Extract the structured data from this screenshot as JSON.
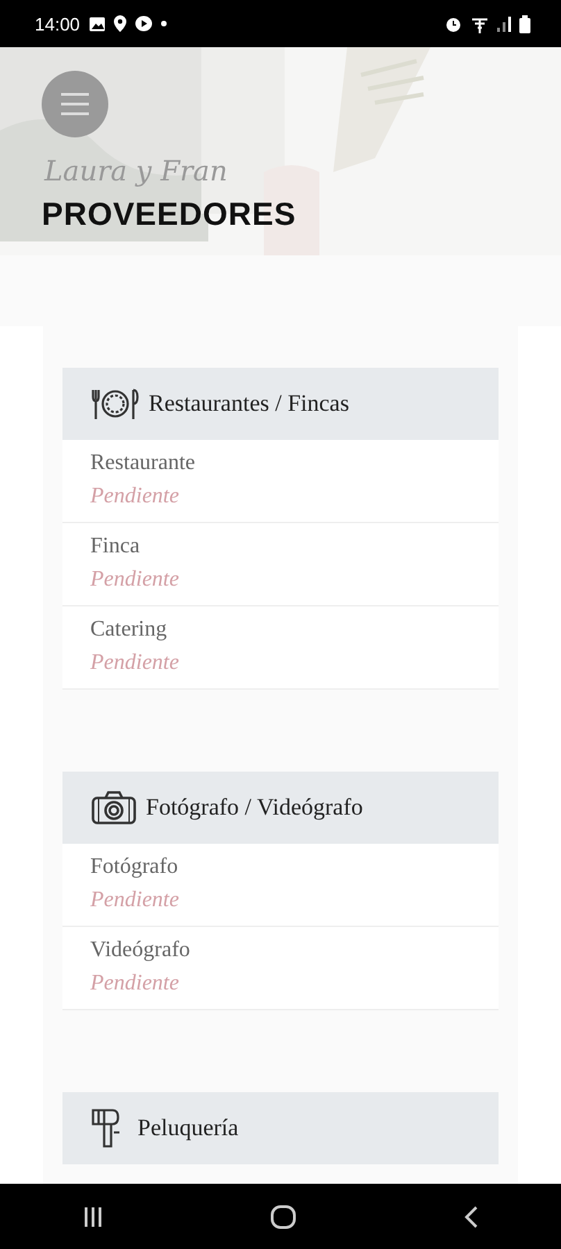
{
  "status_bar": {
    "time": "14:00"
  },
  "header": {
    "logo": "Laura y Fran",
    "title": "PROVEEDORES"
  },
  "sections": [
    {
      "title": "Restaurantes / Fincas",
      "items": [
        {
          "name": "Restaurante",
          "status": "Pendiente"
        },
        {
          "name": "Finca",
          "status": "Pendiente"
        },
        {
          "name": "Catering",
          "status": "Pendiente"
        }
      ]
    },
    {
      "title": "Fotógrafo / Videógrafo",
      "items": [
        {
          "name": "Fotógrafo",
          "status": "Pendiente"
        },
        {
          "name": "Videógrafo",
          "status": "Pendiente"
        }
      ]
    },
    {
      "title": "Peluquería"
    }
  ]
}
